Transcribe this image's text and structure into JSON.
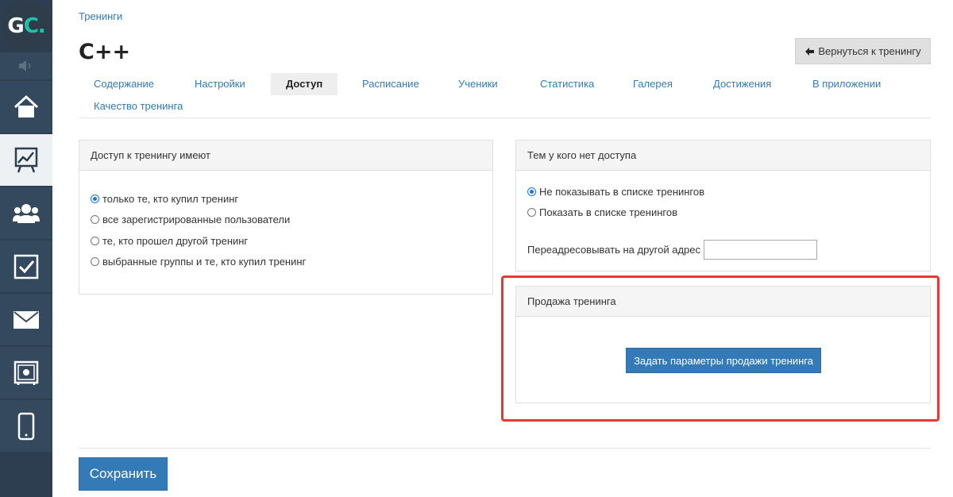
{
  "logo": {
    "text_main": "G",
    "text_accent": "C."
  },
  "sidebar": {
    "items": [
      {
        "icon": "home-icon"
      },
      {
        "icon": "chart-board-icon",
        "active": true
      },
      {
        "icon": "users-icon"
      },
      {
        "icon": "checkbox-icon"
      },
      {
        "icon": "mail-icon"
      },
      {
        "icon": "safe-icon"
      },
      {
        "icon": "mobile-icon"
      }
    ]
  },
  "breadcrumb": "Тренинги",
  "page_title": "C++",
  "back_button": {
    "label": "Вернуться к тренингу",
    "icon": "arrow-left-icon"
  },
  "tabs": [
    {
      "label": "Содержание"
    },
    {
      "label": "Настройки"
    },
    {
      "label": "Доступ",
      "active": true
    },
    {
      "label": "Расписание"
    },
    {
      "label": "Ученики"
    },
    {
      "label": "Статистика"
    },
    {
      "label": "Галерея"
    },
    {
      "label": "Достижения"
    },
    {
      "label": "В приложении"
    },
    {
      "label": "Качество тренинга"
    }
  ],
  "access_panel": {
    "title": "Доступ к тренингу имеют",
    "options": [
      {
        "label": "только те, кто купил тренинг",
        "checked": true
      },
      {
        "label": "все зарегистрированные пользователи",
        "checked": false
      },
      {
        "label": "те, кто прошел другой тренинг",
        "checked": false
      },
      {
        "label": "выбранные группы и те, кто купил тренинг",
        "checked": false
      }
    ]
  },
  "no_access_panel": {
    "title": "Тем у кого нет доступа",
    "options": [
      {
        "label": "Не показывать в списке тренингов",
        "checked": true
      },
      {
        "label": "Показать в списке тренингов",
        "checked": false
      }
    ],
    "redirect_label": "Переадресовывать на другой адрес",
    "redirect_value": ""
  },
  "sale_panel": {
    "title": "Продажа тренинга",
    "button_label": "Задать параметры продажи тренинга"
  },
  "save_button": {
    "label": "Сохранить"
  },
  "colors": {
    "accent": "#337ab7",
    "sidebar": "#2c3e50",
    "highlight": "#e53935",
    "logo_accent": "#1bc3a8"
  }
}
